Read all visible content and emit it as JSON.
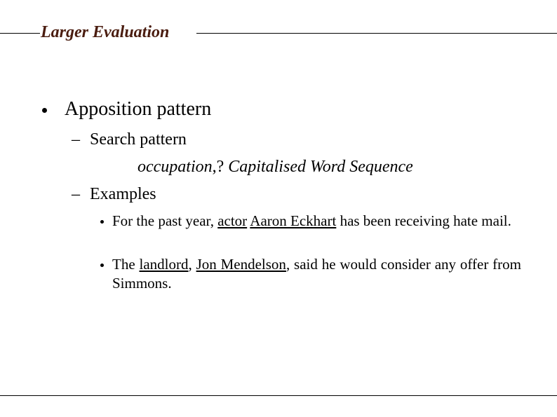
{
  "slide": {
    "title": "Larger Evaluation",
    "title_color": "#4a1c0f",
    "main_bullet": "Apposition pattern",
    "sub_items": [
      {
        "marker": "–",
        "label": "Search pattern"
      },
      {
        "marker": "–",
        "label": "Examples"
      }
    ],
    "search_pattern": {
      "part1": "occupation",
      "separator": ",?",
      "part2": " Capitalised Word Sequence"
    },
    "examples": [
      {
        "segments": [
          {
            "text": "For the past year, ",
            "underline": false
          },
          {
            "text": "actor",
            "underline": true
          },
          {
            "text": " ",
            "underline": false
          },
          {
            "text": "Aaron Eckhart",
            "underline": true
          },
          {
            "text": " has been receiving hate mail.",
            "underline": false
          }
        ]
      },
      {
        "segments": [
          {
            "text": "The ",
            "underline": false
          },
          {
            "text": "landlord",
            "underline": true
          },
          {
            "text": ", ",
            "underline": false
          },
          {
            "text": "Jon Mendelson",
            "underline": true
          },
          {
            "text": ", said he would consider any offer from Simmons.",
            "underline": false
          }
        ]
      }
    ]
  }
}
